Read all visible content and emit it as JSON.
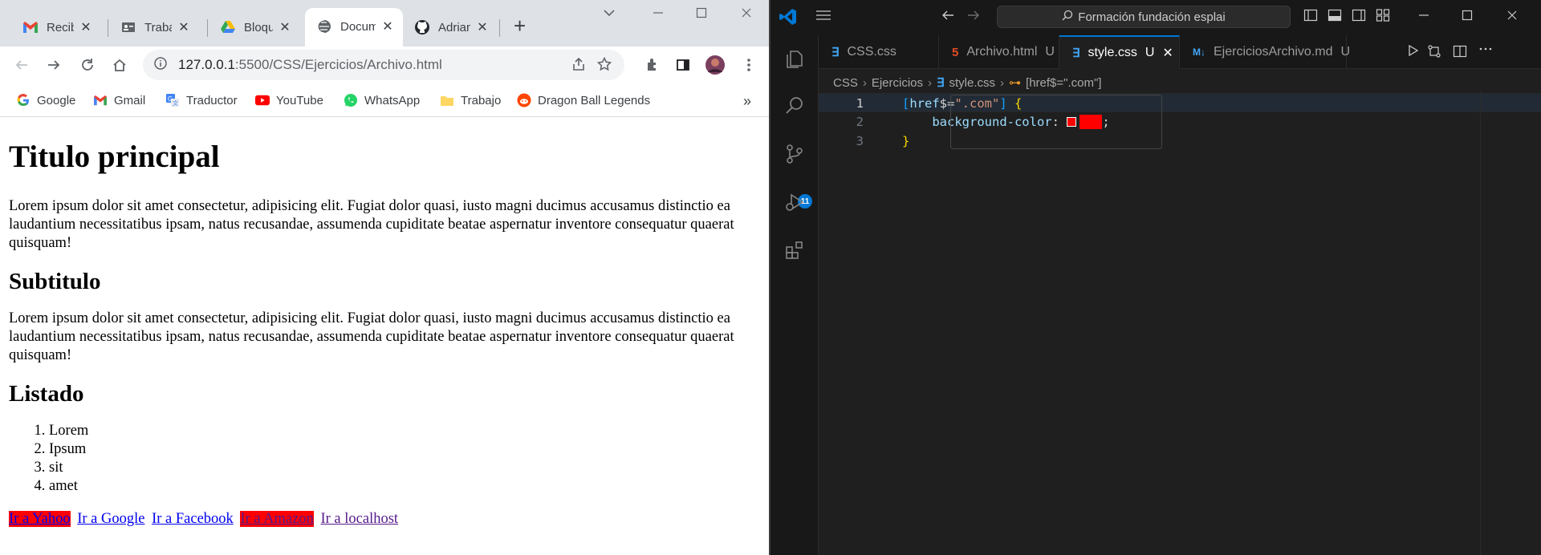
{
  "chrome": {
    "tabs": [
      {
        "title": "Recibi",
        "icon": "gmail-icon"
      },
      {
        "title": "Trabaj",
        "icon": "id-card-icon"
      },
      {
        "title": "Bloque",
        "icon": "drive-icon"
      },
      {
        "title": "Docum",
        "icon": "globe-icon"
      },
      {
        "title": "Adrian",
        "icon": "github-icon"
      }
    ],
    "new_tab": "+",
    "url_host": "127.0.0.1",
    "url_path": ":5500/CSS/Ejercicios/Archivo.html",
    "bookmarks": [
      {
        "label": "Google",
        "icon": "google-icon"
      },
      {
        "label": "Gmail",
        "icon": "gmail-icon"
      },
      {
        "label": "Traductor",
        "icon": "translate-icon"
      },
      {
        "label": "YouTube",
        "icon": "youtube-icon"
      },
      {
        "label": "WhatsApp",
        "icon": "whatsapp-icon"
      },
      {
        "label": "Trabajo",
        "icon": "folder-icon"
      },
      {
        "label": "Dragon Ball Legends",
        "icon": "reddit-icon"
      }
    ],
    "bookmarks_more": "»"
  },
  "page": {
    "h1": "Titulo principal",
    "p1": "Lorem ipsum dolor sit amet consectetur, adipisicing elit. Fugiat dolor quasi, iusto magni ducimus accusamus distinctio ea laudantium necessitatibus ipsam, natus recusandae, assumenda cupiditate beatae aspernatur inventore consequatur quaerat quisquam!",
    "h2a": "Subtitulo",
    "p2": "Lorem ipsum dolor sit amet consectetur, adipisicing elit. Fugiat dolor quasi, iusto magni ducimus accusamus distinctio ea laudantium necessitatibus ipsam, natus recusandae, assumenda cupiditate beatae aspernatur inventore consequatur quaerat quisquam!",
    "h2b": "Listado",
    "list": [
      "Lorem",
      "Ipsum",
      "sit",
      "amet"
    ],
    "links": [
      "Ir a Yahoo",
      "Ir a Google",
      "Ir a Facebook",
      "Ir a Amazon",
      "Ir a localhost"
    ]
  },
  "vscode": {
    "search": "Formación fundación esplai",
    "badge": "11",
    "tabs": [
      {
        "label": "CSS.css",
        "icon": "css-file-icon",
        "mod": ""
      },
      {
        "label": "Archivo.html",
        "icon": "html-file-icon",
        "mod": "U"
      },
      {
        "label": "style.css",
        "icon": "css-file-icon",
        "mod": "U"
      },
      {
        "label": "EjerciciosArchivo.md",
        "icon": "markdown-file-icon",
        "mod": "U"
      }
    ],
    "breadcrumb": [
      "CSS",
      "Ejercicios",
      "style.css",
      "[href$=\".com\"]"
    ],
    "code": {
      "line_numbers": [
        "1",
        "2",
        "3"
      ],
      "selector_open": "[",
      "attr": "href",
      "op": "$=",
      "str": "\".com\"",
      "selector_close": "]",
      "brace_open": "{",
      "prop": "background-color",
      "colon": ": ",
      "value": "red",
      "semicolon": ";",
      "brace_close": "}"
    }
  },
  "colors": {
    "vscode_accent": "#0078d4",
    "chrome_tabstrip": "#dee1e6",
    "link_highlight": "#ff0000"
  }
}
